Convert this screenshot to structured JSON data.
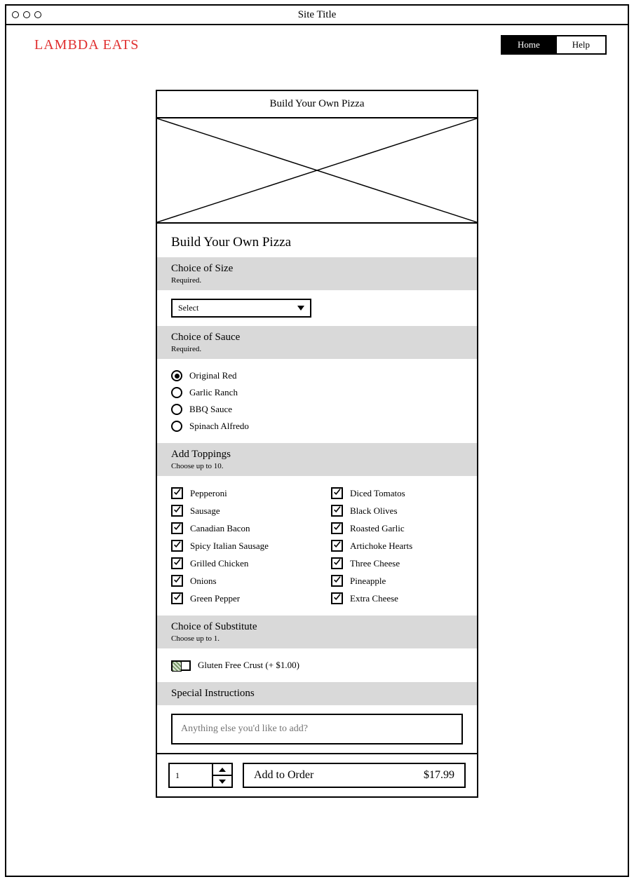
{
  "window": {
    "site_title": "Site Title"
  },
  "header": {
    "brand": "LAMBDA EATS",
    "nav": {
      "home": "Home",
      "help": "Help"
    }
  },
  "form": {
    "card_title": "Build Your Own Pizza",
    "heading": "Build Your Own Pizza",
    "size": {
      "title": "Choice of Size",
      "sub": "Required.",
      "select_label": "Select"
    },
    "sauce": {
      "title": "Choice of Sauce",
      "sub": "Required.",
      "options": [
        "Original Red",
        "Garlic Ranch",
        "BBQ Sauce",
        "Spinach Alfredo"
      ],
      "selected_index": 0
    },
    "toppings": {
      "title": "Add Toppings",
      "sub": "Choose up to 10.",
      "left": [
        "Pepperoni",
        "Sausage",
        "Canadian Bacon",
        "Spicy Italian Sausage",
        "Grilled Chicken",
        "Onions",
        "Green Pepper"
      ],
      "right": [
        "Diced Tomatos",
        "Black Olives",
        "Roasted Garlic",
        "Artichoke Hearts",
        "Three Cheese",
        "Pineapple",
        "Extra Cheese"
      ]
    },
    "substitute": {
      "title": "Choice of Substitute",
      "sub": "Choose up to 1.",
      "option": "Gluten Free Crust (+ $1.00)"
    },
    "instructions": {
      "title": "Special Instructions",
      "placeholder": "Anything else you'd like to add?"
    },
    "footer": {
      "quantity": "1",
      "add_label": "Add to Order",
      "price": "$17.99"
    }
  }
}
